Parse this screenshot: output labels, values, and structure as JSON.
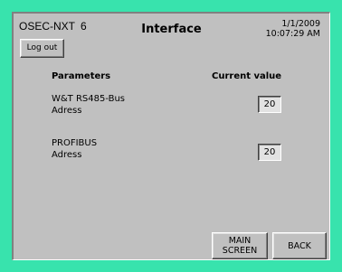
{
  "header": {
    "device_name": "OSEC-NXT",
    "device_number": "6",
    "title": "Interface",
    "date": "1/1/2009",
    "time": "10:07:29 AM",
    "logout_label": "Log out"
  },
  "table": {
    "col_parameters": "Parameters",
    "col_value": "Current value",
    "rows": [
      {
        "line1": "W&T RS485-Bus",
        "line2": "Adress",
        "value": "20"
      },
      {
        "line1": "PROFIBUS",
        "line2": "Adress",
        "value": "20"
      }
    ]
  },
  "footer": {
    "main_line1": "MAIN",
    "main_line2": "SCREEN",
    "back_label": "BACK"
  }
}
